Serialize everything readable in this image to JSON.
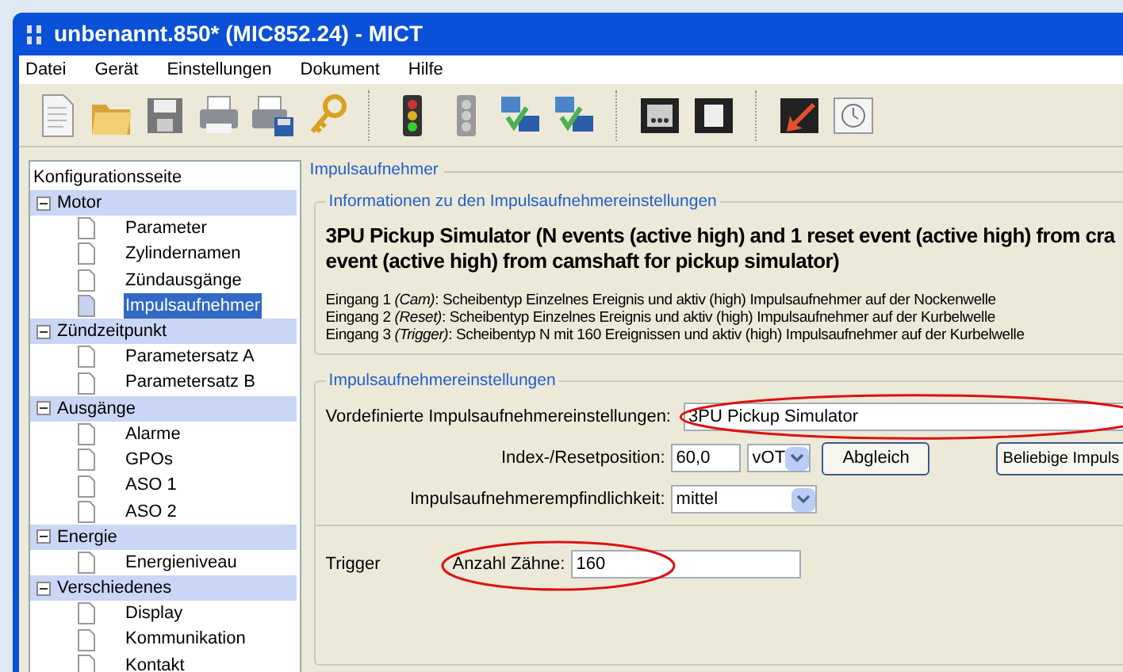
{
  "window": {
    "title": "unbenannt.850* (MIC852.24) - MICT"
  },
  "menu": [
    "Datei",
    "Gerät",
    "Einstellungen",
    "Dokument",
    "Hilfe"
  ],
  "toolbar": [
    {
      "kind": "document"
    },
    {
      "kind": "folder"
    },
    {
      "kind": "floppy"
    },
    {
      "kind": "printer"
    },
    {
      "kind": "printer-save"
    },
    {
      "kind": "key"
    },
    {
      "kind": "separator"
    },
    {
      "kind": "traffic-light"
    },
    {
      "kind": "traffic-light-off"
    },
    {
      "kind": "network"
    },
    {
      "kind": "network-alt"
    },
    {
      "kind": "separator"
    },
    {
      "kind": "panel"
    },
    {
      "kind": "scroll"
    },
    {
      "kind": "separator"
    },
    {
      "kind": "arrow"
    },
    {
      "kind": "clock"
    }
  ],
  "tree": {
    "header": "Konfigurationsseite",
    "items": [
      {
        "label": "Motor",
        "expanded": true,
        "children": [
          {
            "label": "Parameter",
            "selected": false
          },
          {
            "label": "Zylindernamen",
            "selected": false
          },
          {
            "label": "Zündausgänge",
            "selected": false
          },
          {
            "label": "Impulsaufnehmer",
            "selected": true
          }
        ]
      },
      {
        "label": "Zündzeitpunkt",
        "expanded": true,
        "children": [
          {
            "label": "Parametersatz A",
            "selected": false
          },
          {
            "label": "Parametersatz B",
            "selected": false
          }
        ]
      },
      {
        "label": "Ausgänge",
        "expanded": true,
        "children": [
          {
            "label": "Alarme",
            "selected": false
          },
          {
            "label": "GPOs",
            "selected": false
          },
          {
            "label": "ASO 1",
            "selected": false
          },
          {
            "label": "ASO 2",
            "selected": false
          }
        ]
      },
      {
        "label": "Energie",
        "expanded": true,
        "children": [
          {
            "label": "Energieniveau",
            "selected": false
          }
        ]
      },
      {
        "label": "Verschiedenes",
        "expanded": true,
        "children": [
          {
            "label": "Display",
            "selected": false
          },
          {
            "label": "Kommunikation",
            "selected": false
          },
          {
            "label": "Kontakt",
            "selected": false
          }
        ]
      }
    ]
  },
  "page": {
    "title": "Impulsaufnehmer",
    "info": {
      "title": "Informationen zu den Impulsaufnehmereinstellungen",
      "heading_lines": [
        "3PU Pickup Simulator (N events (active high) and 1 reset event (active high) from cra",
        "event (active high) from camshaft for pickup simulator)"
      ],
      "inputs": [
        "Eingang 1 *(Cam)*: Scheibentyp Einzelnes Ereignis und aktiv (high) Impulsaufnehmer auf der Nockenwelle",
        "Eingang 2 *(Reset)*: Scheibentyp Einzelnes Ereignis und aktiv (high) Impulsaufnehmer auf der Kurbelwelle",
        "Eingang 3 *(Trigger)*: Scheibentyp N mit 160 Ereignissen und aktiv (high) Impulsaufnehmer auf der Kurbelwelle"
      ]
    },
    "settings": {
      "title": "Impulsaufnehmereinstellungen",
      "preset_label": "Vordefinierte Impulsaufnehmereinstellungen:",
      "preset_value": "3PU Pickup Simulator",
      "preset_highlighted": true,
      "index_label": "Index-/Resetposition:",
      "index_value": "60,0",
      "index_unit": "vOT",
      "adjust_button": "Abgleich",
      "any_button": "Beliebige Impuls",
      "sensitivity_label": "Impulsaufnehmerempfindlichkeit:",
      "sensitivity_value": "mittel"
    },
    "trigger": {
      "label": "Trigger",
      "teeth_label": "Anzahl Zähne:",
      "teeth_value": "160",
      "teeth_highlighted": true
    }
  }
}
